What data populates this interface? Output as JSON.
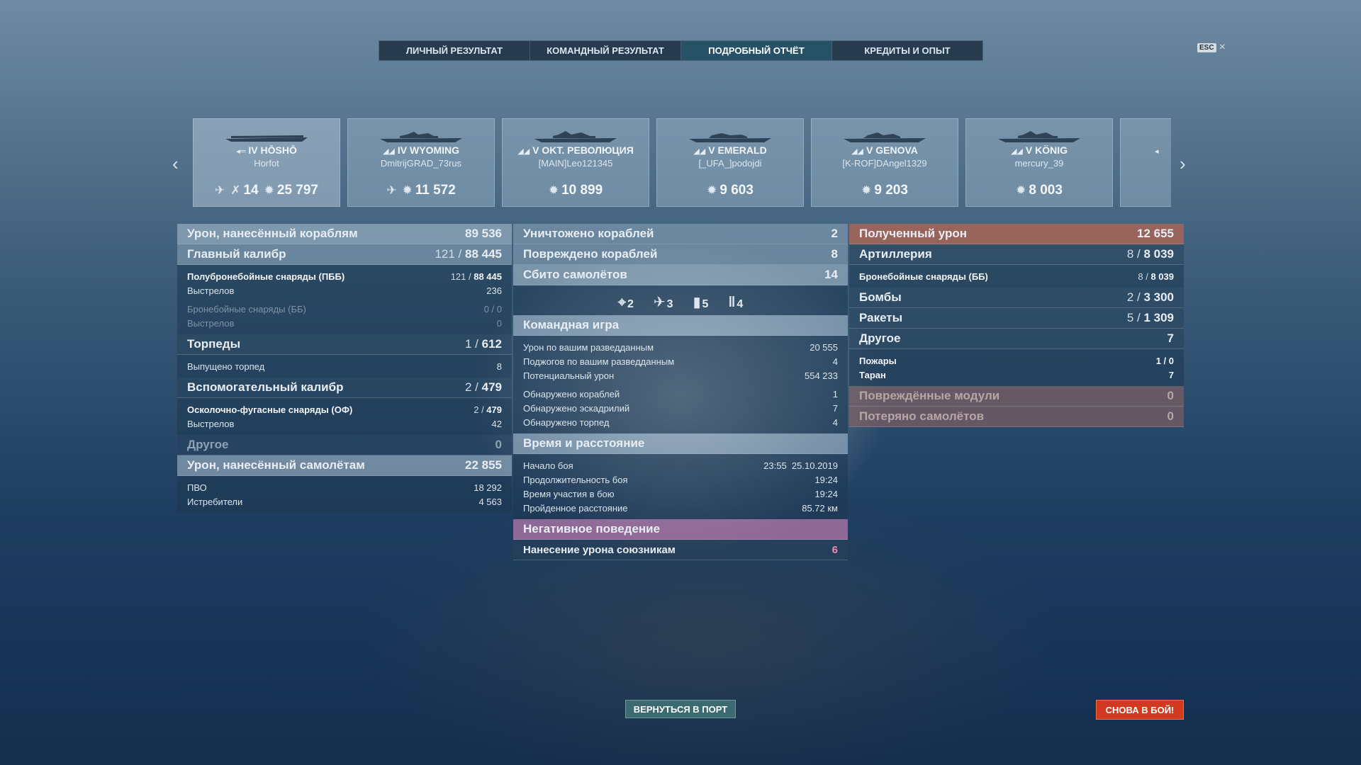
{
  "tabs": [
    {
      "label": "ЛИЧНЫЙ РЕЗУЛЬТАТ",
      "active": false
    },
    {
      "label": "КОМАНДНЫЙ РЕЗУЛЬТАТ",
      "active": false
    },
    {
      "label": "ПОДРОБНЫЙ ОТЧЁТ",
      "active": true
    },
    {
      "label": "КРЕДИТЫ И ОПЫТ",
      "active": false
    }
  ],
  "esc_label": "ESC",
  "ships": [
    {
      "tier": "IV",
      "name": "HŌSHŌ",
      "player": "Horfot",
      "planes": "14",
      "damage": "25 797"
    },
    {
      "tier": "IV",
      "name": "WYOMING",
      "player": "DmitrijGRAD_73rus",
      "damage": "11 572"
    },
    {
      "tier": "V",
      "name": "OKT. РЕВОЛЮЦИЯ",
      "player": "[MAIN]Leo121345",
      "damage": "10 899"
    },
    {
      "tier": "V",
      "name": "EMERALD",
      "player": "[_UFA_]podojdi",
      "damage": "9 603"
    },
    {
      "tier": "V",
      "name": "GENOVA",
      "player": "[K-ROF]DAngel1329",
      "damage": "9 203"
    },
    {
      "tier": "V",
      "name": "KÖNIG",
      "player": "mercury_39",
      "damage": "8 003"
    }
  ],
  "left": {
    "ship_damage": {
      "label": "Урон, нанесённый кораблям",
      "value": "89 536"
    },
    "main_battery": {
      "label": "Главный калибр",
      "hits": "121",
      "value": "88 445"
    },
    "ap_shells": {
      "label": "Полубронебойные снаряды (ПББ)",
      "hits": "121",
      "value": "88 445"
    },
    "ap_shots": {
      "label": "Выстрелов",
      "value": "236"
    },
    "ap2_shells": {
      "label": "Бронебойные снаряды (ББ)",
      "value": "0 / 0"
    },
    "ap2_shots": {
      "label": "Выстрелов",
      "value": "0"
    },
    "torpedoes": {
      "label": "Торпеды",
      "hits": "1",
      "value": "612"
    },
    "torp_launched": {
      "label": "Выпущено торпед",
      "value": "8"
    },
    "secondary": {
      "label": "Вспомогательный калибр",
      "hits": "2",
      "value": "479"
    },
    "he_shells": {
      "label": "Осколочно-фугасные снаряды (ОФ)",
      "hits": "2",
      "value": "479"
    },
    "he_shots": {
      "label": "Выстрелов",
      "value": "42"
    },
    "other": {
      "label": "Другое",
      "value": "0"
    },
    "plane_damage": {
      "label": "Урон, нанесённый самолётам",
      "value": "22 855"
    },
    "aa": {
      "label": "ПВО",
      "value": "18 292"
    },
    "fighters": {
      "label": "Истребители",
      "value": "4 563"
    }
  },
  "middle": {
    "destroyed": {
      "label": "Уничтожено кораблей",
      "value": "2"
    },
    "damaged": {
      "label": "Повреждено кораблей",
      "value": "8"
    },
    "planes_shot": {
      "label": "Сбито самолётов",
      "value": "14"
    },
    "plane_types": [
      {
        "icon": "crosshair-icon",
        "value": "2"
      },
      {
        "icon": "fighter-plane-icon",
        "value": "3"
      },
      {
        "icon": "bomb-icon",
        "value": "5"
      },
      {
        "icon": "rockets-icon",
        "value": "4"
      }
    ],
    "team_play": {
      "label": "Командная игра"
    },
    "spot_damage": {
      "label": "Урон по вашим разведданным",
      "value": "20 555"
    },
    "spot_fires": {
      "label": "Поджогов по вашим разведданным",
      "value": "4"
    },
    "potential": {
      "label": "Потенциальный урон",
      "value": "554 233"
    },
    "spotted_ships": {
      "label": "Обнаружено кораблей",
      "value": "1"
    },
    "spotted_squadrons": {
      "label": "Обнаружено эскадрилий",
      "value": "7"
    },
    "spotted_torps": {
      "label": "Обнаружено торпед",
      "value": "4"
    },
    "time_distance": {
      "label": "Время и расстояние"
    },
    "battle_start": {
      "label": "Начало боя",
      "value": "23:55  25.10.2019"
    },
    "battle_duration": {
      "label": "Продолжительность боя",
      "value": "19:24"
    },
    "time_in_battle": {
      "label": "Время участия в бою",
      "value": "19:24"
    },
    "distance": {
      "label": "Пройденное расстояние",
      "value": "85.72 км"
    },
    "negative": {
      "label": "Негативное поведение"
    },
    "team_damage": {
      "label": "Нанесение урона союзникам",
      "value": "6"
    }
  },
  "right": {
    "received": {
      "label": "Полученный урон",
      "value": "12 655"
    },
    "artillery": {
      "label": "Артиллерия",
      "hits": "8",
      "value": "8 039"
    },
    "ap_received": {
      "label": "Бронебойные снаряды (ББ)",
      "hits": "8",
      "value": "8 039"
    },
    "bombs": {
      "label": "Бомбы",
      "hits": "2",
      "value": "3 300"
    },
    "rockets": {
      "label": "Ракеты",
      "hits": "5",
      "value": "1 309"
    },
    "other": {
      "label": "Другое",
      "value": "7"
    },
    "fires": {
      "label": "Пожары",
      "value": "1 / 0"
    },
    "ram": {
      "label": "Таран",
      "value": "7"
    },
    "modules": {
      "label": "Повреждённые модули",
      "value": "0"
    },
    "lost_planes": {
      "label": "Потеряно самолётов",
      "value": "0"
    }
  },
  "buttons": {
    "port": "ВЕРНУТЬСЯ В ПОРТ",
    "battle": "СНОВА В БОЙ!"
  }
}
